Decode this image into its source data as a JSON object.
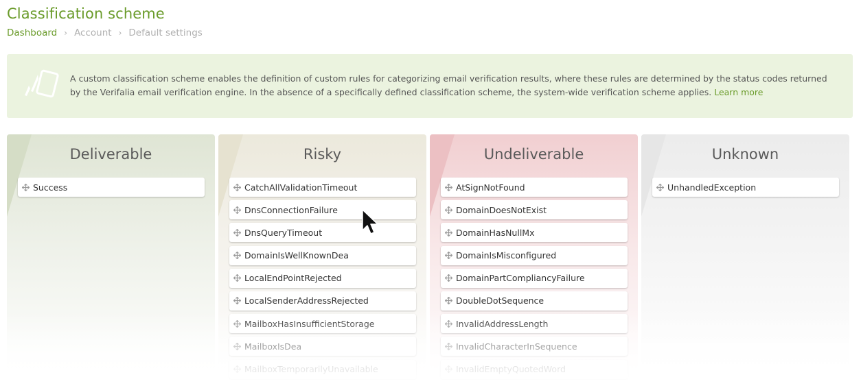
{
  "header": {
    "title": "Classification scheme",
    "breadcrumb": [
      "Dashboard",
      "Account",
      "Default settings"
    ]
  },
  "info": {
    "text": "A custom classification scheme enables the definition of custom rules for categorizing email verification results, where these rules are determined by the status codes returned by the Verifalia email verification engine. In the absence of a specifically defined classification scheme, the system-wide verification scheme applies.",
    "learn_more": "Learn more",
    "icon": "cards-icon"
  },
  "columns": [
    {
      "title": "Deliverable",
      "color": "#dfe5d4",
      "items": [
        "Success"
      ]
    },
    {
      "title": "Risky",
      "color": "#ece9dc",
      "items": [
        "CatchAllValidationTimeout",
        "DnsConnectionFailure",
        "DnsQueryTimeout",
        "DomainIsWellKnownDea",
        "LocalEndPointRejected",
        "LocalSenderAddressRejected",
        "MailboxHasInsufficientStorage",
        "MailboxIsDea",
        "MailboxTemporarilyUnavailable"
      ]
    },
    {
      "title": "Undeliverable",
      "color": "#f1cfd1",
      "items": [
        "AtSignNotFound",
        "DomainDoesNotExist",
        "DomainHasNullMx",
        "DomainIsMisconfigured",
        "DomainPartCompliancyFailure",
        "DoubleDotSequence",
        "InvalidAddressLength",
        "InvalidCharacterInSequence",
        "InvalidEmptyQuotedWord"
      ]
    },
    {
      "title": "Unknown",
      "color": "#ececec",
      "items": [
        "UnhandledException"
      ]
    }
  ],
  "colors": {
    "accent": "#6a9b2a",
    "info_background": "#ebf3df"
  }
}
